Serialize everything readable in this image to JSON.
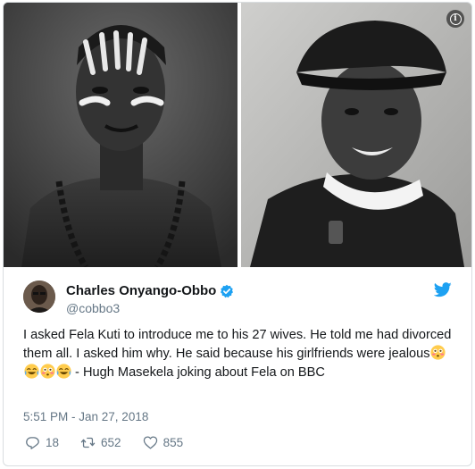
{
  "author": {
    "display_name": "Charles Onyango-Obbo",
    "handle": "@cobbo3"
  },
  "tweet": {
    "text_part1": "I asked Fela Kuti to introduce me to his 27 wives. He told me had divorced them all. I asked him why. He said because his girlfriends were jealous",
    "emojis": [
      "flushed-face",
      "face-with-tears-of-joy",
      "flushed-face",
      "face-with-tears-of-joy"
    ],
    "text_part2": " - Hugh Masekela joking about Fela on BBC",
    "timestamp": "5:51 PM - Jan 27, 2018"
  },
  "actions": {
    "replies": "18",
    "retweets": "652",
    "likes": "855"
  },
  "colors": {
    "brand_blue": "#1da1f2",
    "text_primary": "#14171a",
    "text_secondary": "#657786",
    "border": "#d9dde0"
  }
}
